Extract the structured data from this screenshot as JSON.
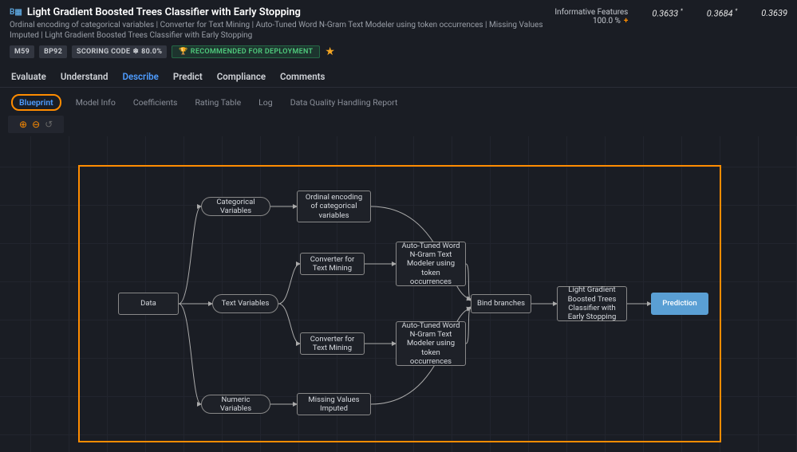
{
  "header": {
    "title": "Light Gradient Boosted Trees Classifier with Early Stopping",
    "subtitle": "Ordinal encoding of categorical variables | Converter for Text Mining | Auto-Tuned Word N-Gram Text Modeler using token occurrences | Missing Values Imputed | Light Gradient Boosted Trees Classifier with Early Stopping",
    "badge_m": "M59",
    "badge_bp": "BP92",
    "badge_scoring": "SCORING CODE",
    "badge_pct": "80.0%",
    "badge_recommend": "RECOMMENDED FOR DEPLOYMENT",
    "informative_label": "Informative Features",
    "informative_value": "100.0 %",
    "metric1": "0.3633",
    "metric2": "0.3684",
    "metric3": "0.3639"
  },
  "tabs": {
    "items": [
      "Evaluate",
      "Understand",
      "Describe",
      "Predict",
      "Compliance",
      "Comments"
    ]
  },
  "subtabs": {
    "items": [
      "Blueprint",
      "Model Info",
      "Coefficients",
      "Rating Table",
      "Log",
      "Data Quality Handling Report"
    ]
  },
  "nodes": {
    "data": "Data",
    "categorical": "Categorical Variables",
    "text_vars": "Text Variables",
    "numeric": "Numeric Variables",
    "ordinal": "Ordinal encoding of categorical variables",
    "conv1": "Converter for Text Mining",
    "conv2": "Converter for Text Mining",
    "ngram1": "Auto-Tuned Word N-Gram Text Modeler using token occurrences",
    "ngram2": "Auto-Tuned Word N-Gram Text Modeler using token occurrences",
    "missing": "Missing Values Imputed",
    "bind": "Bind branches",
    "lgbt": "Light Gradient Boosted Trees Classifier with Early Stopping",
    "prediction": "Prediction"
  }
}
